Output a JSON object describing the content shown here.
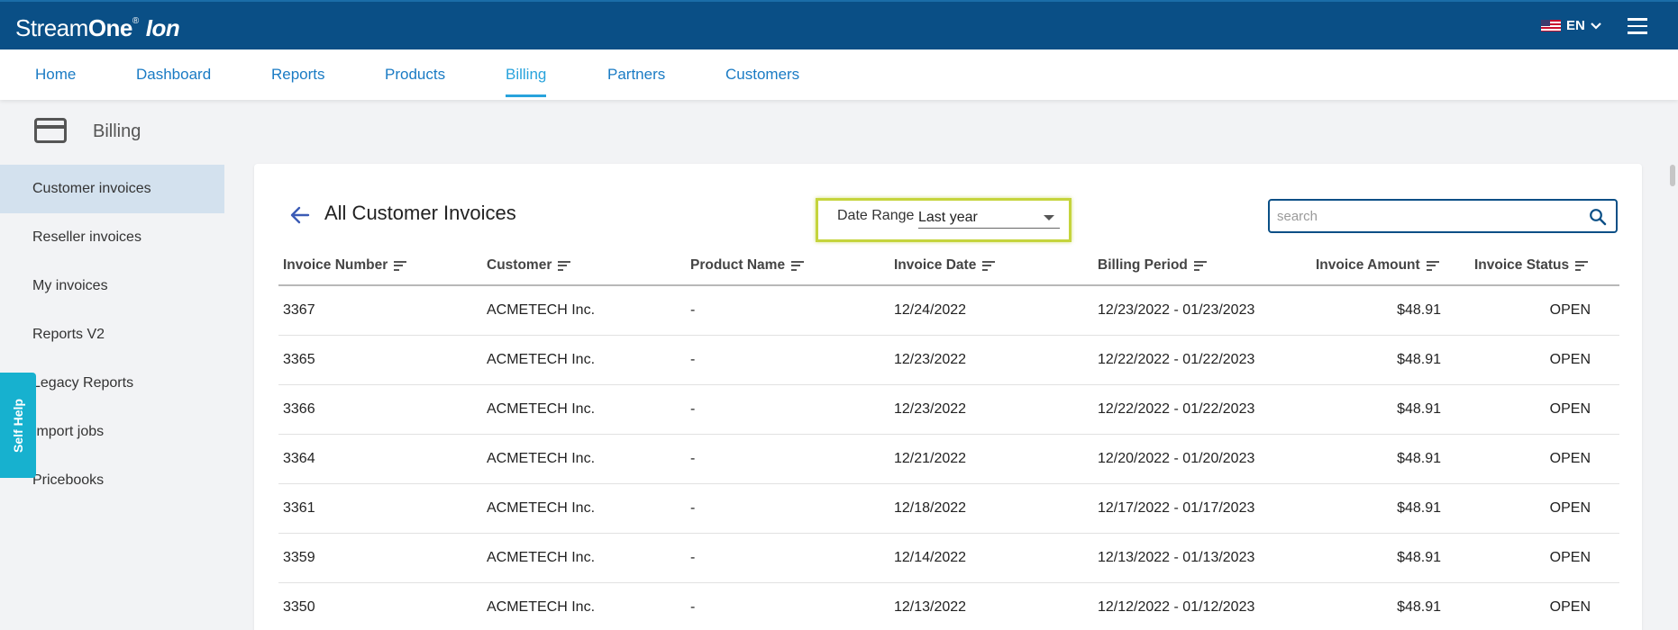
{
  "brand": {
    "stream": "Stream",
    "one": "One",
    "reg": "®",
    "ion": "Ion"
  },
  "language": {
    "code": "EN",
    "flag_icon": "us-flag-icon"
  },
  "nav": {
    "items": [
      {
        "label": "Home"
      },
      {
        "label": "Dashboard"
      },
      {
        "label": "Reports"
      },
      {
        "label": "Products"
      },
      {
        "label": "Billing",
        "active": true
      },
      {
        "label": "Partners"
      },
      {
        "label": "Customers"
      }
    ]
  },
  "page": {
    "title": "Billing",
    "icon": "credit-card-icon"
  },
  "sidebar": {
    "items": [
      {
        "label": "Customer invoices",
        "active": true
      },
      {
        "label": "Reseller invoices"
      },
      {
        "label": "My invoices"
      },
      {
        "label": "Reports V2"
      },
      {
        "label": "Legacy Reports"
      },
      {
        "label": "Import jobs"
      },
      {
        "label": "Pricebooks"
      }
    ]
  },
  "self_help": {
    "label": "Self Help"
  },
  "main": {
    "title": "All Customer Invoices",
    "date_range": {
      "label": "Date Range",
      "value": "Last year"
    },
    "search": {
      "placeholder": "search",
      "value": ""
    },
    "columns": [
      "Invoice Number",
      "Customer",
      "Product Name",
      "Invoice Date",
      "Billing Period",
      "Invoice Amount",
      "Invoice Status"
    ],
    "rows": [
      {
        "number": "3367",
        "customer": "ACMETECH Inc.",
        "product": "-",
        "date": "12/24/2022",
        "period": "12/23/2022 - 01/23/2023",
        "amount": "$48.91",
        "status": "OPEN"
      },
      {
        "number": "3365",
        "customer": "ACMETECH Inc.",
        "product": "-",
        "date": "12/23/2022",
        "period": "12/22/2022 - 01/22/2023",
        "amount": "$48.91",
        "status": "OPEN"
      },
      {
        "number": "3366",
        "customer": "ACMETECH Inc.",
        "product": "-",
        "date": "12/23/2022",
        "period": "12/22/2022 - 01/22/2023",
        "amount": "$48.91",
        "status": "OPEN"
      },
      {
        "number": "3364",
        "customer": "ACMETECH Inc.",
        "product": "-",
        "date": "12/21/2022",
        "period": "12/20/2022 - 01/20/2023",
        "amount": "$48.91",
        "status": "OPEN"
      },
      {
        "number": "3361",
        "customer": "ACMETECH Inc.",
        "product": "-",
        "date": "12/18/2022",
        "period": "12/17/2022 - 01/17/2023",
        "amount": "$48.91",
        "status": "OPEN"
      },
      {
        "number": "3359",
        "customer": "ACMETECH Inc.",
        "product": "-",
        "date": "12/14/2022",
        "period": "12/13/2022 - 01/13/2023",
        "amount": "$48.91",
        "status": "OPEN"
      },
      {
        "number": "3350",
        "customer": "ACMETECH Inc.",
        "product": "-",
        "date": "12/13/2022",
        "period": "12/12/2022 - 01/12/2023",
        "amount": "$48.91",
        "status": "OPEN"
      }
    ]
  },
  "colors": {
    "header": "#0a4f86",
    "link": "#1a7bc4",
    "active_tab": "#28a3dc",
    "highlight": "#c5d43c",
    "self_help": "#17b1cf"
  }
}
